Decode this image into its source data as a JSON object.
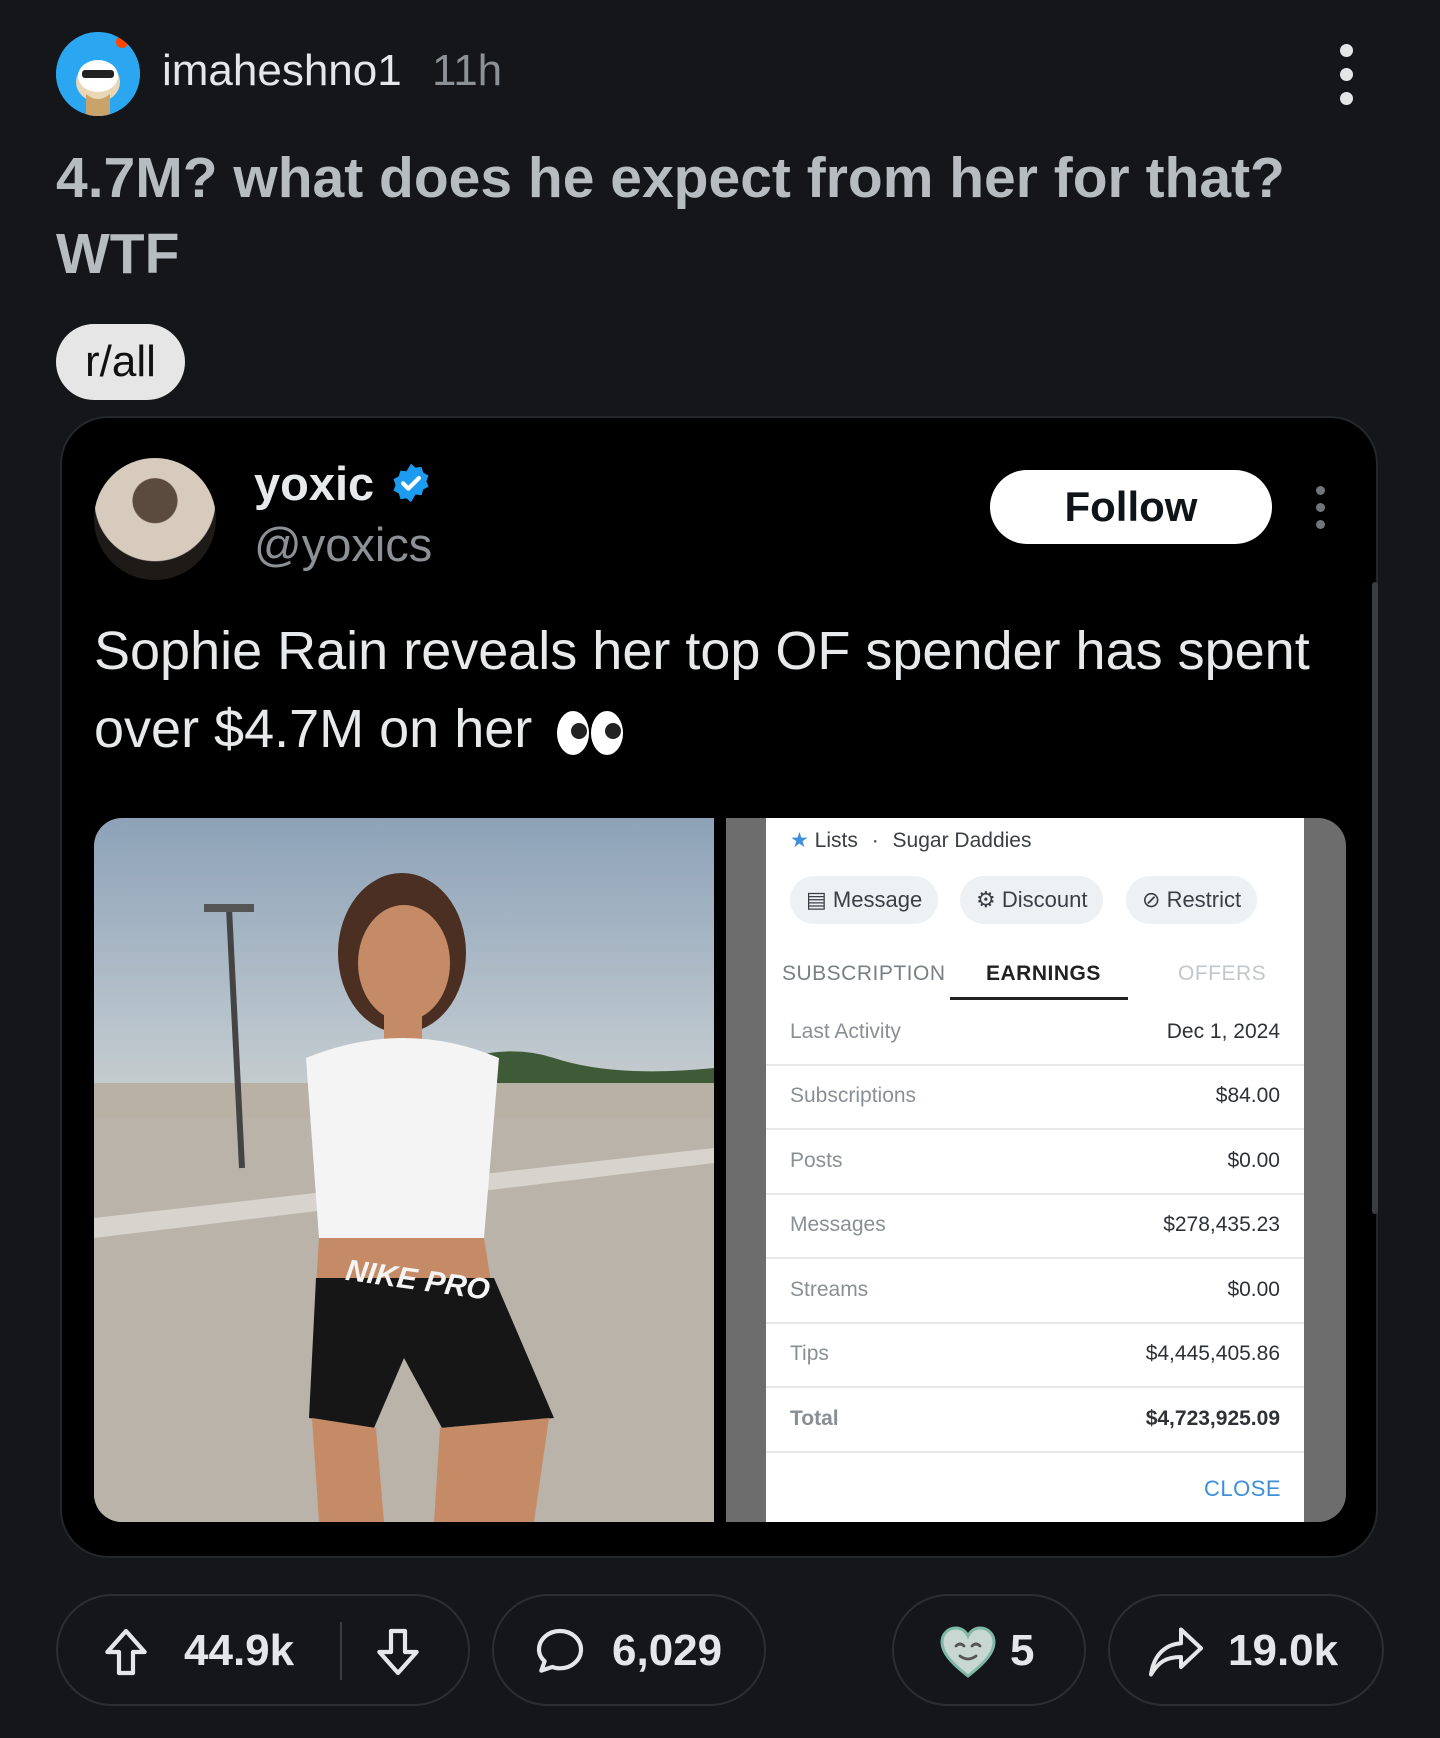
{
  "post": {
    "author": "imaheshno1",
    "age": "11h",
    "title": "4.7M? what does he expect from her for that? WTF",
    "community_chip": "r/all"
  },
  "tweet": {
    "name": "yoxic",
    "handle": "@yoxics",
    "follow_label": "Follow",
    "text": "Sophie Rain reveals her top OF spender has spent over $4.7M on her",
    "emoji": "eyes-emoji",
    "photo_text": "NIKE PRO",
    "screenshot": {
      "breadcrumb": [
        "Lists",
        "Sugar Daddies"
      ],
      "actions": [
        "Message",
        "Discount",
        "Restrict"
      ],
      "tabs": [
        "SUBSCRIPTION",
        "EARNINGS",
        "OFFERS"
      ],
      "active_tab": "EARNINGS",
      "rows": [
        {
          "label": "Last Activity",
          "value": "Dec 1, 2024"
        },
        {
          "label": "Subscriptions",
          "value": "$84.00"
        },
        {
          "label": "Posts",
          "value": "$0.00"
        },
        {
          "label": "Messages",
          "value": "$278,435.23"
        },
        {
          "label": "Streams",
          "value": "$0.00"
        },
        {
          "label": "Tips",
          "value": "$4,445,405.86"
        },
        {
          "label": "Total",
          "value": "$4,723,925.09"
        }
      ],
      "close_label": "CLOSE"
    }
  },
  "actions": {
    "upvotes": "44.9k",
    "comments": "6,029",
    "awards": "5",
    "shares": "19.0k"
  },
  "colors": {
    "background": "#14161a",
    "card": "#000000",
    "verified": "#1d9bf0",
    "close_link": "#3e8fd8"
  }
}
